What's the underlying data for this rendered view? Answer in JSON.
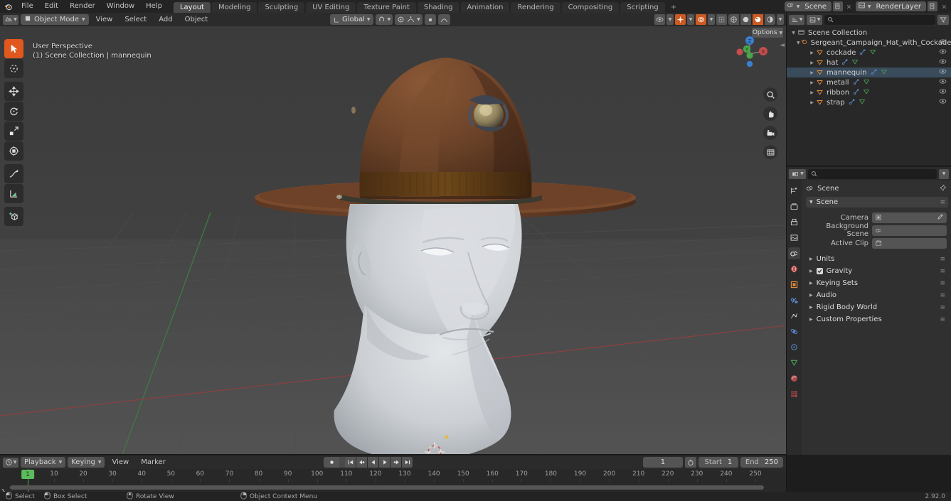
{
  "app": {
    "name": "Blender",
    "version": "2.92.0"
  },
  "topbar": {
    "menus": [
      "File",
      "Edit",
      "Render",
      "Window",
      "Help"
    ],
    "workspace_tabs": [
      {
        "label": "Layout",
        "active": true
      },
      {
        "label": "Modeling",
        "active": false
      },
      {
        "label": "Sculpting",
        "active": false
      },
      {
        "label": "UV Editing",
        "active": false
      },
      {
        "label": "Texture Paint",
        "active": false
      },
      {
        "label": "Shading",
        "active": false
      },
      {
        "label": "Animation",
        "active": false
      },
      {
        "label": "Rendering",
        "active": false
      },
      {
        "label": "Compositing",
        "active": false
      },
      {
        "label": "Scripting",
        "active": false
      },
      {
        "label": "+",
        "active": false
      }
    ],
    "scene_name": "Scene",
    "view_layer_name": "RenderLayer"
  },
  "viewport": {
    "header": {
      "mode": "Object Mode",
      "menus": [
        "View",
        "Select",
        "Add",
        "Object"
      ],
      "transform_orientation": "Global",
      "options_label": "Options"
    },
    "overlay_text_line1": "User Perspective",
    "overlay_text_line2": "(1) Scene Collection | mannequin",
    "gizmo_axes": [
      {
        "label": "Z",
        "color": "#3b7ed0"
      },
      {
        "label": "Y",
        "color": "#4ba54b"
      },
      {
        "label": "X",
        "color": "#c44d4d"
      }
    ],
    "nav_buttons": [
      "zoom-icon",
      "pan-hand-icon",
      "camera-icon",
      "ortho-grid-icon"
    ],
    "tools": [
      {
        "name": "tweak-select-tool",
        "active": true
      },
      {
        "name": "cursor-tool",
        "active": false
      },
      {
        "name": "move-tool",
        "active": false
      },
      {
        "name": "rotate-tool",
        "active": false
      },
      {
        "name": "scale-tool",
        "active": false
      },
      {
        "name": "transform-tool",
        "active": false
      },
      {
        "name": "annotate-tool",
        "active": false
      },
      {
        "name": "measure-tool",
        "active": false
      },
      {
        "name": "add-cube-tool",
        "active": false
      }
    ],
    "scene_objects": {
      "hat_color": "#6b4228",
      "band_color": "#4a3014",
      "strap_color": "#3b3a31",
      "emblem_color": "#8f8266",
      "mannequin_color": "#cfd2d6",
      "background_top": "#3c3c3c",
      "background_bottom": "#4a4a4a",
      "grid_color": "#484848",
      "axis_x_color": "#9c4b4b",
      "axis_y_color": "#4b8a4b"
    }
  },
  "outliner": {
    "search_placeholder": "",
    "root": "Scene Collection",
    "collection": "Sergeant_Campaign_Hat_with_Cockade_Bro",
    "objects": [
      {
        "name": "cockade",
        "selected": false
      },
      {
        "name": "hat",
        "selected": false
      },
      {
        "name": "mannequin",
        "selected": true
      },
      {
        "name": "metall",
        "selected": false
      },
      {
        "name": "ribbon",
        "selected": false
      },
      {
        "name": "strap",
        "selected": false
      }
    ]
  },
  "properties": {
    "search_placeholder": "",
    "breadcrumb": "Scene",
    "tabs": [
      {
        "name": "tool-tab",
        "active": false
      },
      {
        "name": "render-tab",
        "active": false
      },
      {
        "name": "output-tab",
        "active": false
      },
      {
        "name": "view-layer-tab",
        "active": false
      },
      {
        "name": "scene-tab",
        "active": true
      },
      {
        "name": "world-tab",
        "active": false
      },
      {
        "name": "object-tab",
        "active": false
      },
      {
        "name": "modifier-tab",
        "active": false
      },
      {
        "name": "particles-tab",
        "active": false
      },
      {
        "name": "physics-tab",
        "active": false
      },
      {
        "name": "constraints-tab",
        "active": false
      },
      {
        "name": "object-data-tab",
        "active": false
      },
      {
        "name": "material-tab",
        "active": false
      },
      {
        "name": "texture-tab",
        "active": false
      }
    ],
    "scene_panel": {
      "title": "Scene",
      "rows": [
        {
          "label": "Camera",
          "value": "",
          "icon": "camera-data-icon"
        },
        {
          "label": "Background Scene",
          "value": "",
          "icon": "scene-icon"
        },
        {
          "label": "Active Clip",
          "value": "",
          "icon": "clip-icon"
        }
      ]
    },
    "collapsed_panels": [
      {
        "label": "Units",
        "checkbox": false
      },
      {
        "label": "Gravity",
        "checkbox": true
      },
      {
        "label": "Keying Sets",
        "checkbox": false
      },
      {
        "label": "Audio",
        "checkbox": false
      },
      {
        "label": "Rigid Body World",
        "checkbox": false
      },
      {
        "label": "Custom Properties",
        "checkbox": false
      }
    ]
  },
  "timeline": {
    "menus": [
      "Playback",
      "Keying",
      "View",
      "Marker"
    ],
    "playback_label": "Playback",
    "keying_label": "Keying",
    "view_label": "View",
    "marker_label": "Marker",
    "current_frame": "1",
    "start_label": "Start",
    "start_value": "1",
    "end_label": "End",
    "end_value": "250",
    "ticks": [
      10,
      20,
      30,
      40,
      50,
      60,
      70,
      80,
      90,
      100,
      110,
      120,
      130,
      140,
      150,
      160,
      170,
      180,
      190,
      200,
      210,
      220,
      230,
      240,
      250
    ],
    "playhead_frame": 1,
    "playhead_label": "1",
    "playback_buttons": [
      "jump-to-start-icon",
      "previous-keyframe-icon",
      "play-reverse-icon",
      "play-icon",
      "next-keyframe-icon",
      "jump-to-end-icon"
    ]
  },
  "statusbar": {
    "hints": [
      {
        "mouse": "left",
        "label": "Select"
      },
      {
        "mouse": "left-drag",
        "label": "Box Select"
      },
      {
        "mouse": "middle",
        "label": "Rotate View"
      },
      {
        "mouse": "right",
        "label": "Object Context Menu"
      }
    ],
    "version": "2.92.0"
  }
}
